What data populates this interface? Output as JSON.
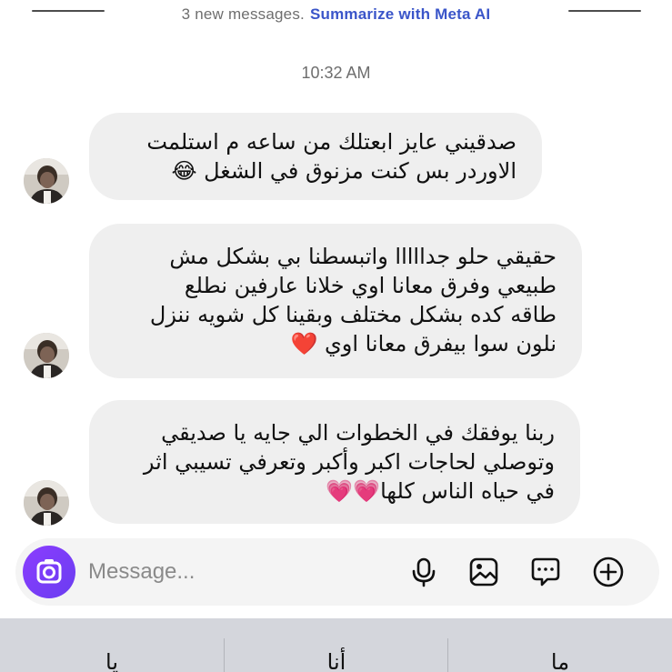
{
  "banner": {
    "new_messages": "3 new messages.",
    "summarize_link": "Summarize with Meta AI"
  },
  "timestamp": "10:32 AM",
  "messages": [
    {
      "lines": [
        "صدقيني عايز ابعتلك من ساعه م استلمت",
        "الاوردر بس كنت مزنوق في الشغل 😂"
      ],
      "avatar_icon": "avatar-photo"
    },
    {
      "lines": [
        "حقيقي حلو جدااااا واتبسطنا بي بشكل مش",
        "طبيعي وفرق معانا اوي خلانا عارفين نطلع",
        "طاقه كده بشكل مختلف وبقينا كل شويه ننزل",
        "نلون سوا بيفرق معانا اوي ❤️"
      ],
      "avatar_icon": "avatar-photo"
    },
    {
      "lines": [
        "ربنا يوفقك في الخطوات الي جايه يا صديقي",
        "وتوصلي لحاجات اكبر وأكبر وتعرفي تسيبي اثر",
        "في حياه الناس كلها💗💗"
      ],
      "avatar_icon": "avatar-photo"
    }
  ],
  "composer": {
    "placeholder": "Message...",
    "icons": [
      "camera-icon",
      "microphone-icon",
      "image-icon",
      "sticker-icon",
      "plus-icon"
    ],
    "accent_color": "#7c3aed"
  },
  "keyboard": {
    "suggestions": [
      "يا",
      "أنا",
      "ما"
    ]
  }
}
